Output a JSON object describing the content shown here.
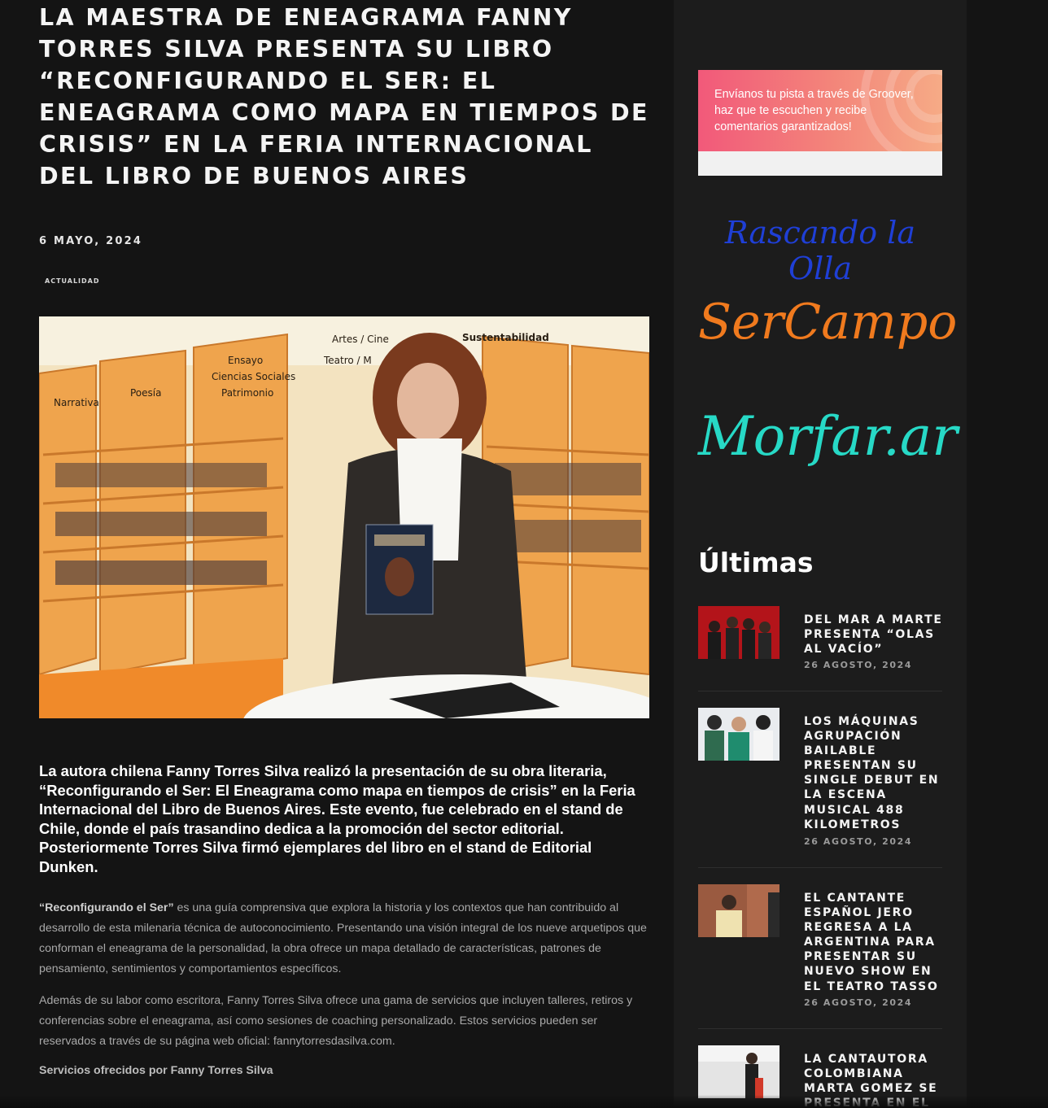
{
  "article": {
    "title": "LA MAESTRA DE ENEAGRAMA FANNY TORRES SILVA PRESENTA SU LIBRO “RECONFIGURANDO EL SER: EL ENEAGRAMA COMO MAPA EN TIEMPOS DE CRISIS” EN LA FERIA INTERNACIONAL DEL LIBRO DE BUENOS AIRES",
    "date": "6 MAYO, 2024",
    "category": "ACTUALIDAD",
    "photo_signs": [
      "Narrativa",
      "Poesía",
      "Ensayo",
      "Ciencias Sociales",
      "Patrimonio",
      "Artes / Cine",
      "Teatro / M",
      "Sustentabilidad"
    ],
    "lead": "La autora chilena Fanny Torres Silva realizó la presentación de su obra literaria, “Reconfigurando el Ser: El Eneagrama como mapa en tiempos de crisis” en la Feria Internacional del Libro de Buenos Aires. Este evento, fue celebrado en el stand de Chile, donde el país trasandino dedica a la promoción del sector editorial. Posteriormente Torres Silva firmó ejemplares del libro en el stand de Editorial Dunken.",
    "p1_bold": "“Reconfigurando el Ser”",
    "p1_rest": " es una guía comprensiva que explora la historia y los contextos que han contribuido al desarrollo de esta milenaria técnica de autoconocimiento. Presentando una visión integral de los nueve arquetipos que conforman el eneagrama de la personalidad, la obra ofrece un mapa detallado de características, patrones de pensamiento, sentimientos y comportamientos específicos.",
    "p2": "Además de su labor como escritora, Fanny Torres Silva ofrece una gama de servicios que incluyen talleres, retiros y conferencias sobre el eneagrama, así como sesiones de coaching personalizado. Estos servicios pueden ser reservados a través de su página web oficial: fannytorresdasilva.com.",
    "services_heading": "Servicios ofrecidos por Fanny Torres Silva"
  },
  "sidebar": {
    "ad_text": "Envíanos tu pista a través de Groover, haz que te escuchen y recibe comentarios garantizados!",
    "logos": [
      "Rascando la Olla",
      "SerCampo",
      "Morfar.ar"
    ],
    "latest_heading": "Últimas",
    "posts": [
      {
        "title": "DEL MAR A MARTE PRESENTA “OLAS AL VACÍO”",
        "date": "26 AGOSTO, 2024"
      },
      {
        "title": "LOS MÁQUINAS AGRUPACIÓN BAILABLE PRESENTAN SU SINGLE DEBUT EN LA ESCENA MUSICAL 488 KILOMETROS",
        "date": "26 AGOSTO, 2024"
      },
      {
        "title": "EL CANTANTE ESPAÑOL JERO REGRESA A LA ARGENTINA PARA PRESENTAR SU NUEVO SHOW EN EL TEATRO TASSO",
        "date": "26 AGOSTO, 2024"
      },
      {
        "title": "LA CANTAUTORA COLOMBIANA MARTA GOMEZ SE PRESENTA EN EL",
        "date": ""
      }
    ]
  },
  "colors": {
    "background": "#141414",
    "sidebar": "#1c1c1c",
    "logo_rascando": "#1f3fd6",
    "logo_sercampo": "#f07a1e",
    "logo_morfar": "#27d9c6"
  }
}
